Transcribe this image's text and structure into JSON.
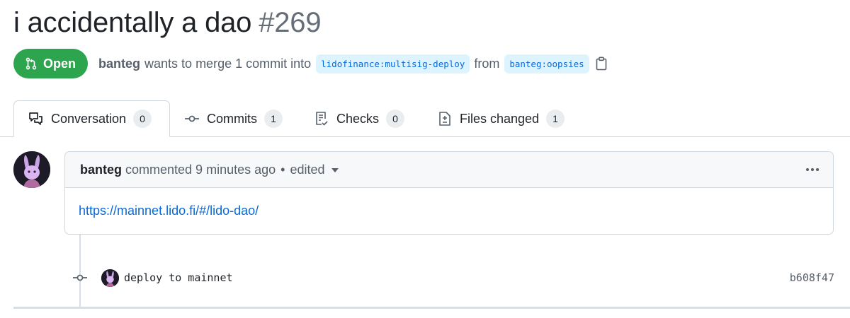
{
  "pr": {
    "title": "i accidentally a dao",
    "number": "#269",
    "state": "Open",
    "author": "banteg",
    "merge_text": "wants to merge 1 commit into",
    "base_branch": "lidofinance:multisig-deploy",
    "from_text": "from",
    "head_branch": "banteg:oopsies"
  },
  "tabs": [
    {
      "label": "Conversation",
      "count": "0",
      "icon": "comment-discussion-icon"
    },
    {
      "label": "Commits",
      "count": "1",
      "icon": "git-commit-icon"
    },
    {
      "label": "Checks",
      "count": "0",
      "icon": "checklist-icon"
    },
    {
      "label": "Files changed",
      "count": "1",
      "icon": "file-diff-icon"
    }
  ],
  "comment": {
    "author": "banteg",
    "action": "commented 9 minutes ago",
    "separator": "•",
    "edited": "edited",
    "body_link": "https://mainnet.lido.fi/#/lido-dao/"
  },
  "commit": {
    "message": "deploy to mainnet",
    "sha": "b608f47"
  },
  "colors": {
    "open_green": "#2da44e",
    "link_blue": "#0969da",
    "branch_bg": "#ddf4ff",
    "border": "#d0d7de"
  }
}
